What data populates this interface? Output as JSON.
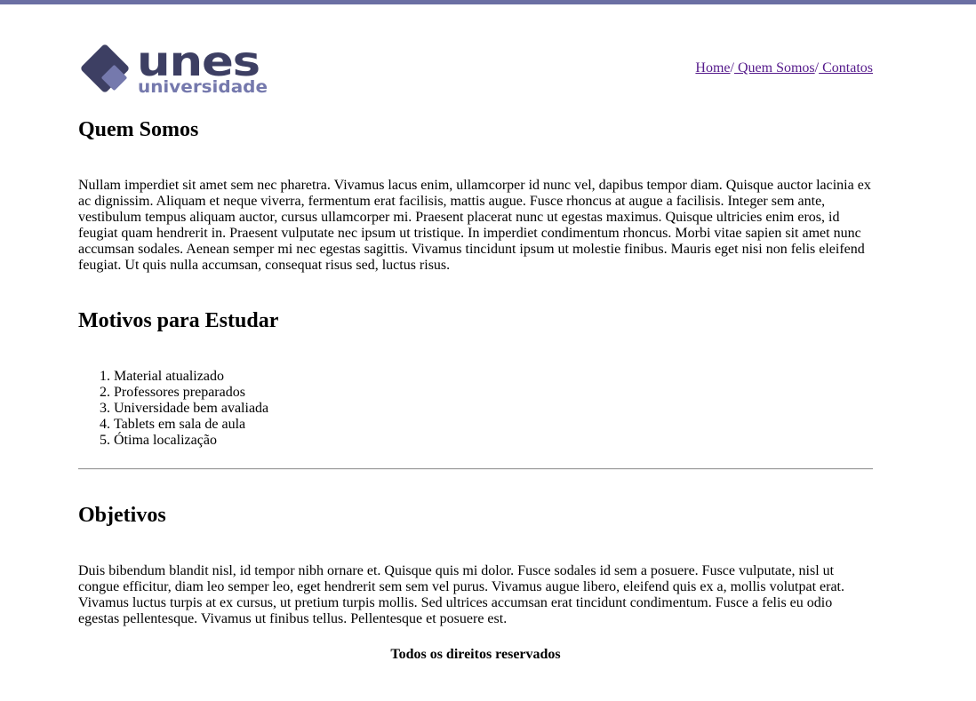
{
  "logo": {
    "wordmark": "unes",
    "subtitle": "universidade",
    "colors": {
      "dark": "#3d3f63",
      "light": "#7579ad"
    }
  },
  "nav": {
    "items": [
      "Home",
      " Quem Somos",
      " Contatos"
    ],
    "separator": "/"
  },
  "quem_somos": {
    "title": "Quem Somos",
    "text": "Nullam imperdiet sit amet sem nec pharetra. Vivamus lacus enim, ullamcorper id nunc vel, dapibus tempor diam. Quisque auctor lacinia ex ac dignissim. Aliquam et neque viverra, fermentum erat facilisis, mattis augue. Fusce rhoncus at augue a facilisis. Integer sem ante, vestibulum tempus aliquam auctor, cursus ullamcorper mi. Praesent placerat nunc ut egestas maximus. Quisque ultricies enim eros, id feugiat quam hendrerit in. Praesent vulputate nec ipsum ut tristique. In imperdiet condimentum rhoncus. Morbi vitae sapien sit amet nunc accumsan sodales. Aenean semper mi nec egestas sagittis. Vivamus tincidunt ipsum ut molestie finibus. Mauris eget nisi non felis eleifend feugiat. Ut quis nulla accumsan, consequat risus sed, luctus risus."
  },
  "motivos": {
    "title": "Motivos para Estudar",
    "items": [
      "Material atualizado",
      "Professores preparados",
      "Universidade bem avaliada",
      "Tablets em sala de aula",
      "Ótima localização"
    ]
  },
  "objetivos": {
    "title": "Objetivos",
    "text": "Duis bibendum blandit nisl, id tempor nibh ornare et. Quisque quis mi dolor. Fusce sodales id sem a posuere. Fusce vulputate, nisl ut congue efficitur, diam leo semper leo, eget hendrerit sem sem vel purus. Vivamus augue libero, eleifend quis ex a, mollis volutpat erat. Vivamus luctus turpis at ex cursus, ut pretium turpis mollis. Sed ultrices accumsan erat tincidunt condimentum. Fusce a felis eu odio egestas pellentesque. Vivamus ut finibus tellus. Pellentesque et posuere est."
  },
  "footer": {
    "text": "Todos os direitos reservados"
  },
  "colors": {
    "top_bar": "#6b6fa3",
    "link": "#551a8b"
  }
}
